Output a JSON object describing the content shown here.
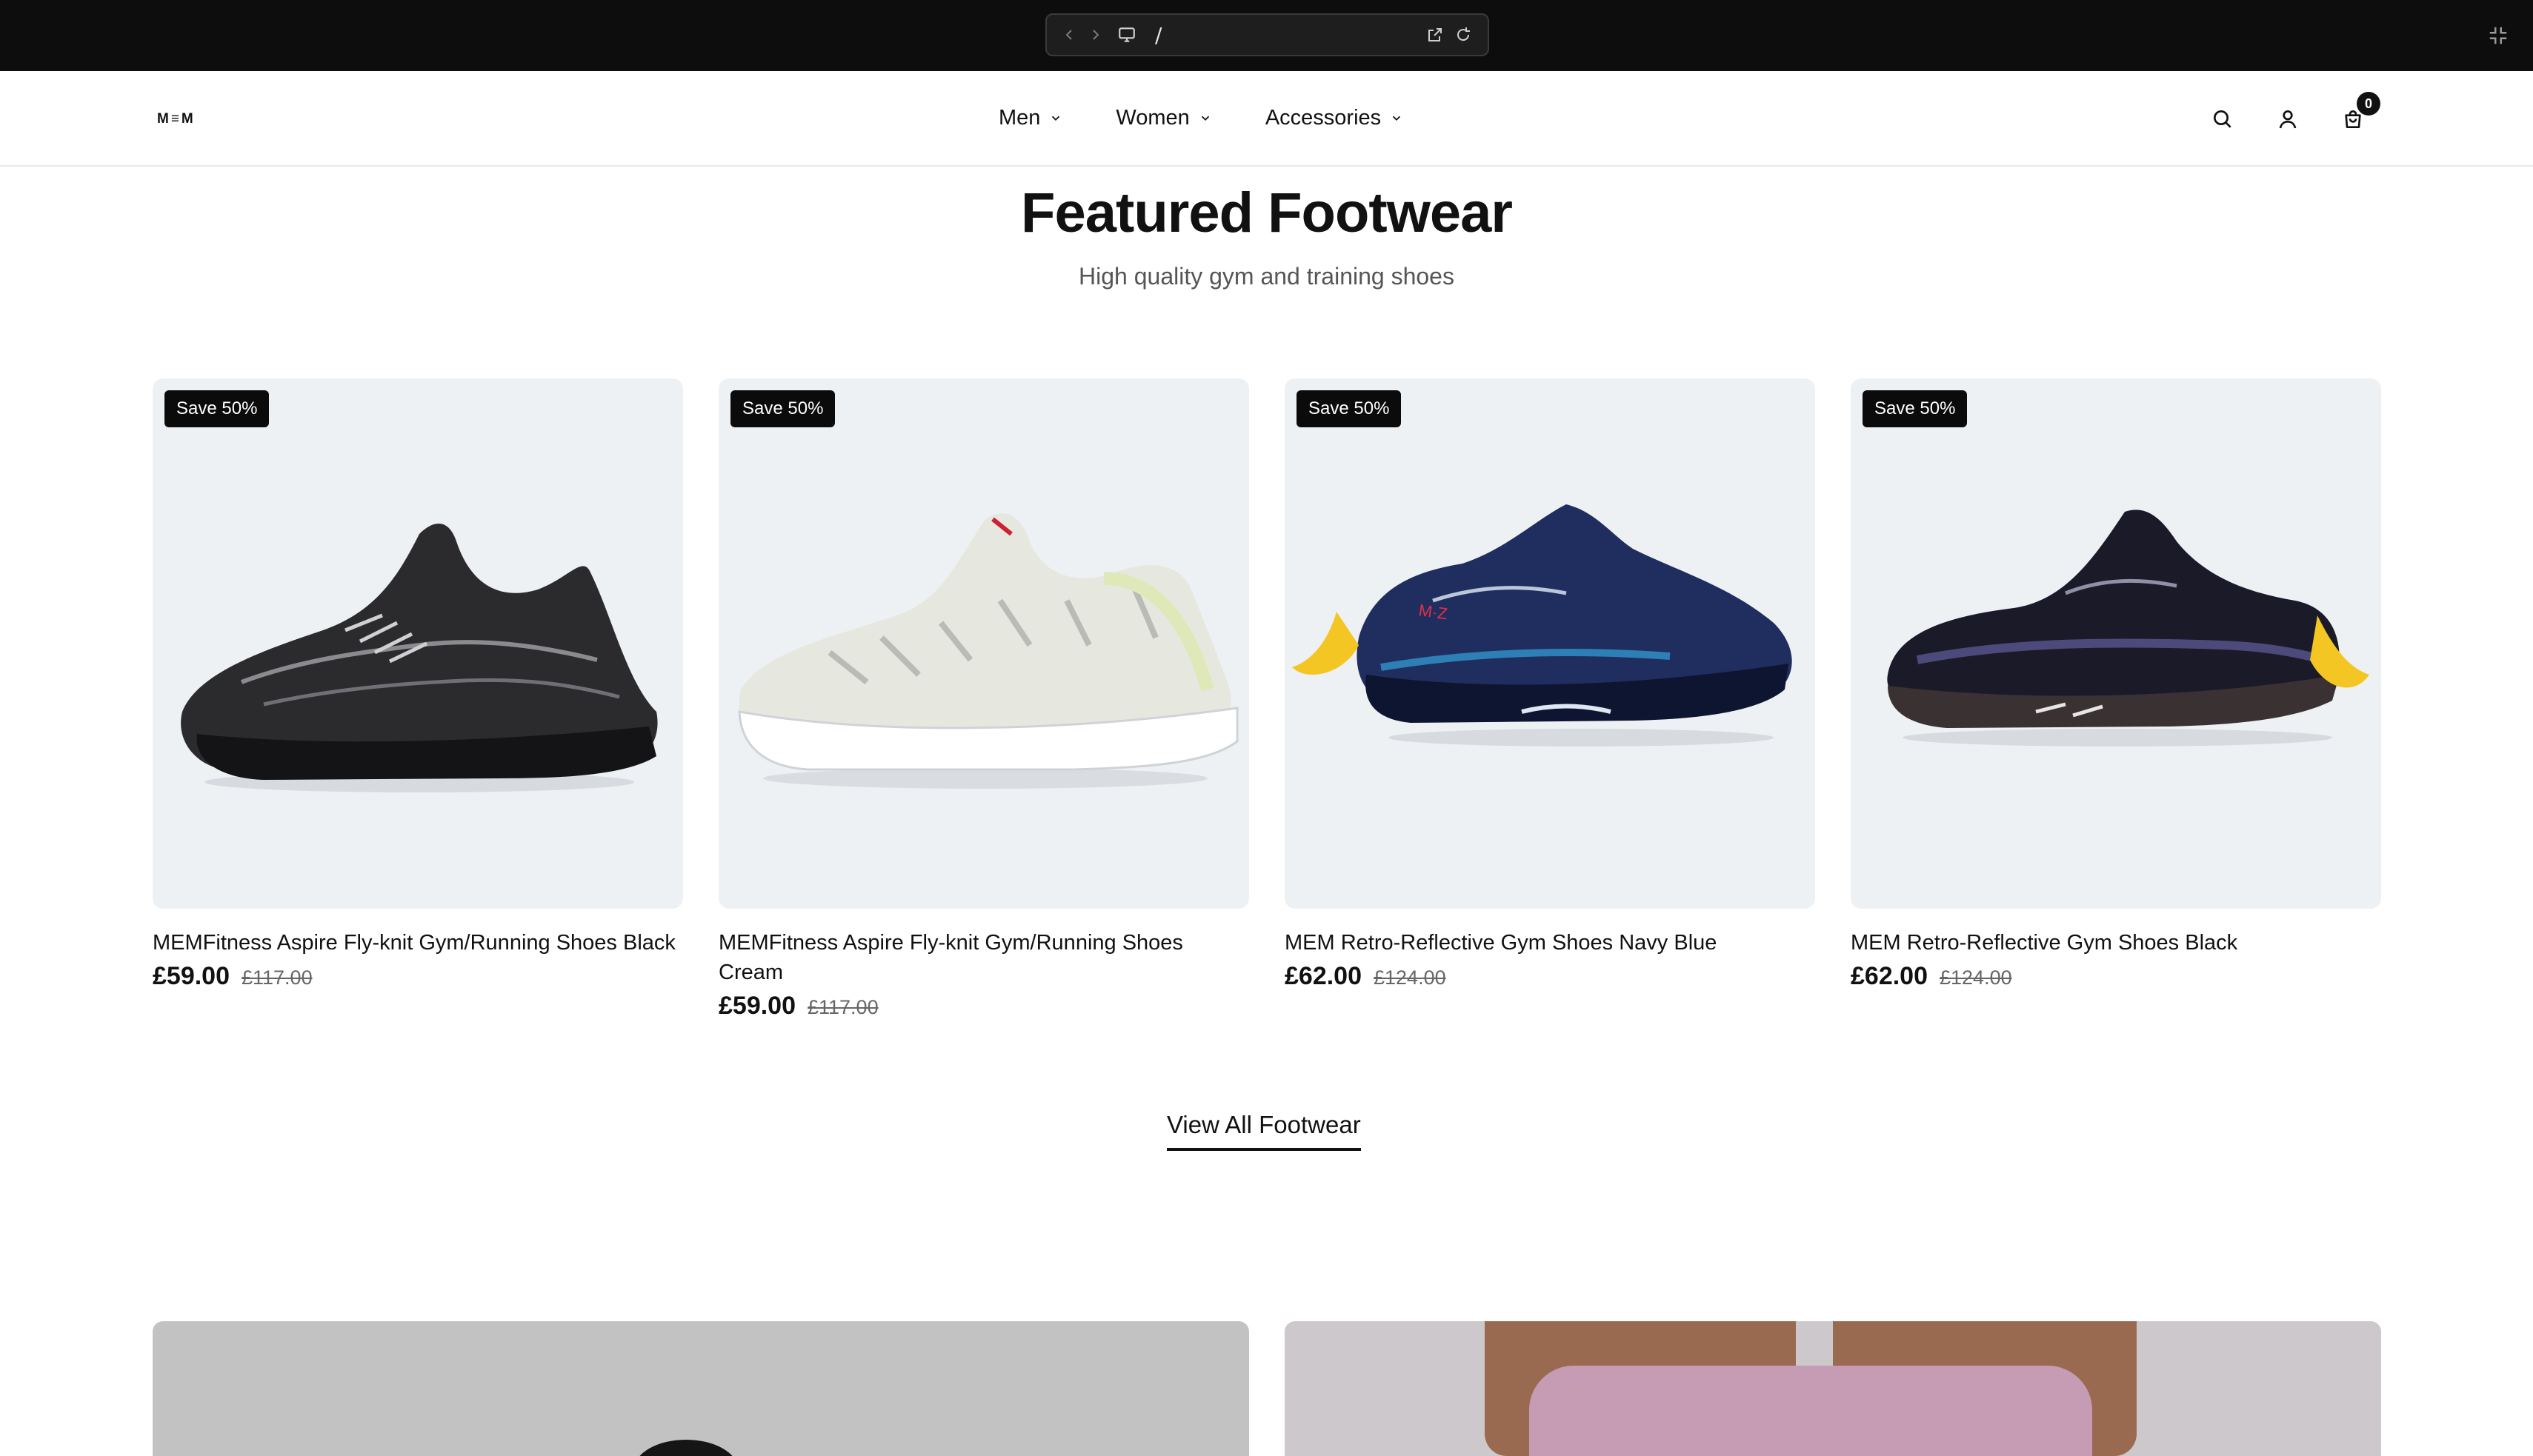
{
  "browser": {
    "url_path": "/"
  },
  "header": {
    "logo": "M≡M",
    "nav": [
      {
        "label": "Men"
      },
      {
        "label": "Women"
      },
      {
        "label": "Accessories"
      }
    ],
    "cart_count": "0",
    "icons": [
      "search-icon",
      "account-icon",
      "cart-icon"
    ]
  },
  "section": {
    "title": "Featured Footwear",
    "subtitle": "High quality gym and training shoes",
    "view_all_label": "View All Footwear"
  },
  "products": [
    {
      "badge": "Save 50%",
      "title": "MEMFitness Aspire Fly-knit Gym/Running Shoes Black",
      "price": "£59.00",
      "compare_price": "£117.00",
      "colorway": "black-knit"
    },
    {
      "badge": "Save 50%",
      "title": "MEMFitness Aspire Fly-knit Gym/Running Shoes Cream",
      "price": "£59.00",
      "compare_price": "£117.00",
      "colorway": "cream-knit"
    },
    {
      "badge": "Save 50%",
      "title": "MEM Retro-Reflective Gym Shoes Navy Blue",
      "price": "£62.00",
      "compare_price": "£124.00",
      "colorway": "navy-reflective"
    },
    {
      "badge": "Save 50%",
      "title": "MEM Retro-Reflective Gym Shoes Black",
      "price": "£62.00",
      "compare_price": "£124.00",
      "colorway": "black-reflective"
    }
  ],
  "colors": {
    "chrome_bg": "#0d0d0d",
    "card_bg": "#eef1f4",
    "badge_bg": "#0b0b0b",
    "logo_accent": "#c8102e"
  }
}
